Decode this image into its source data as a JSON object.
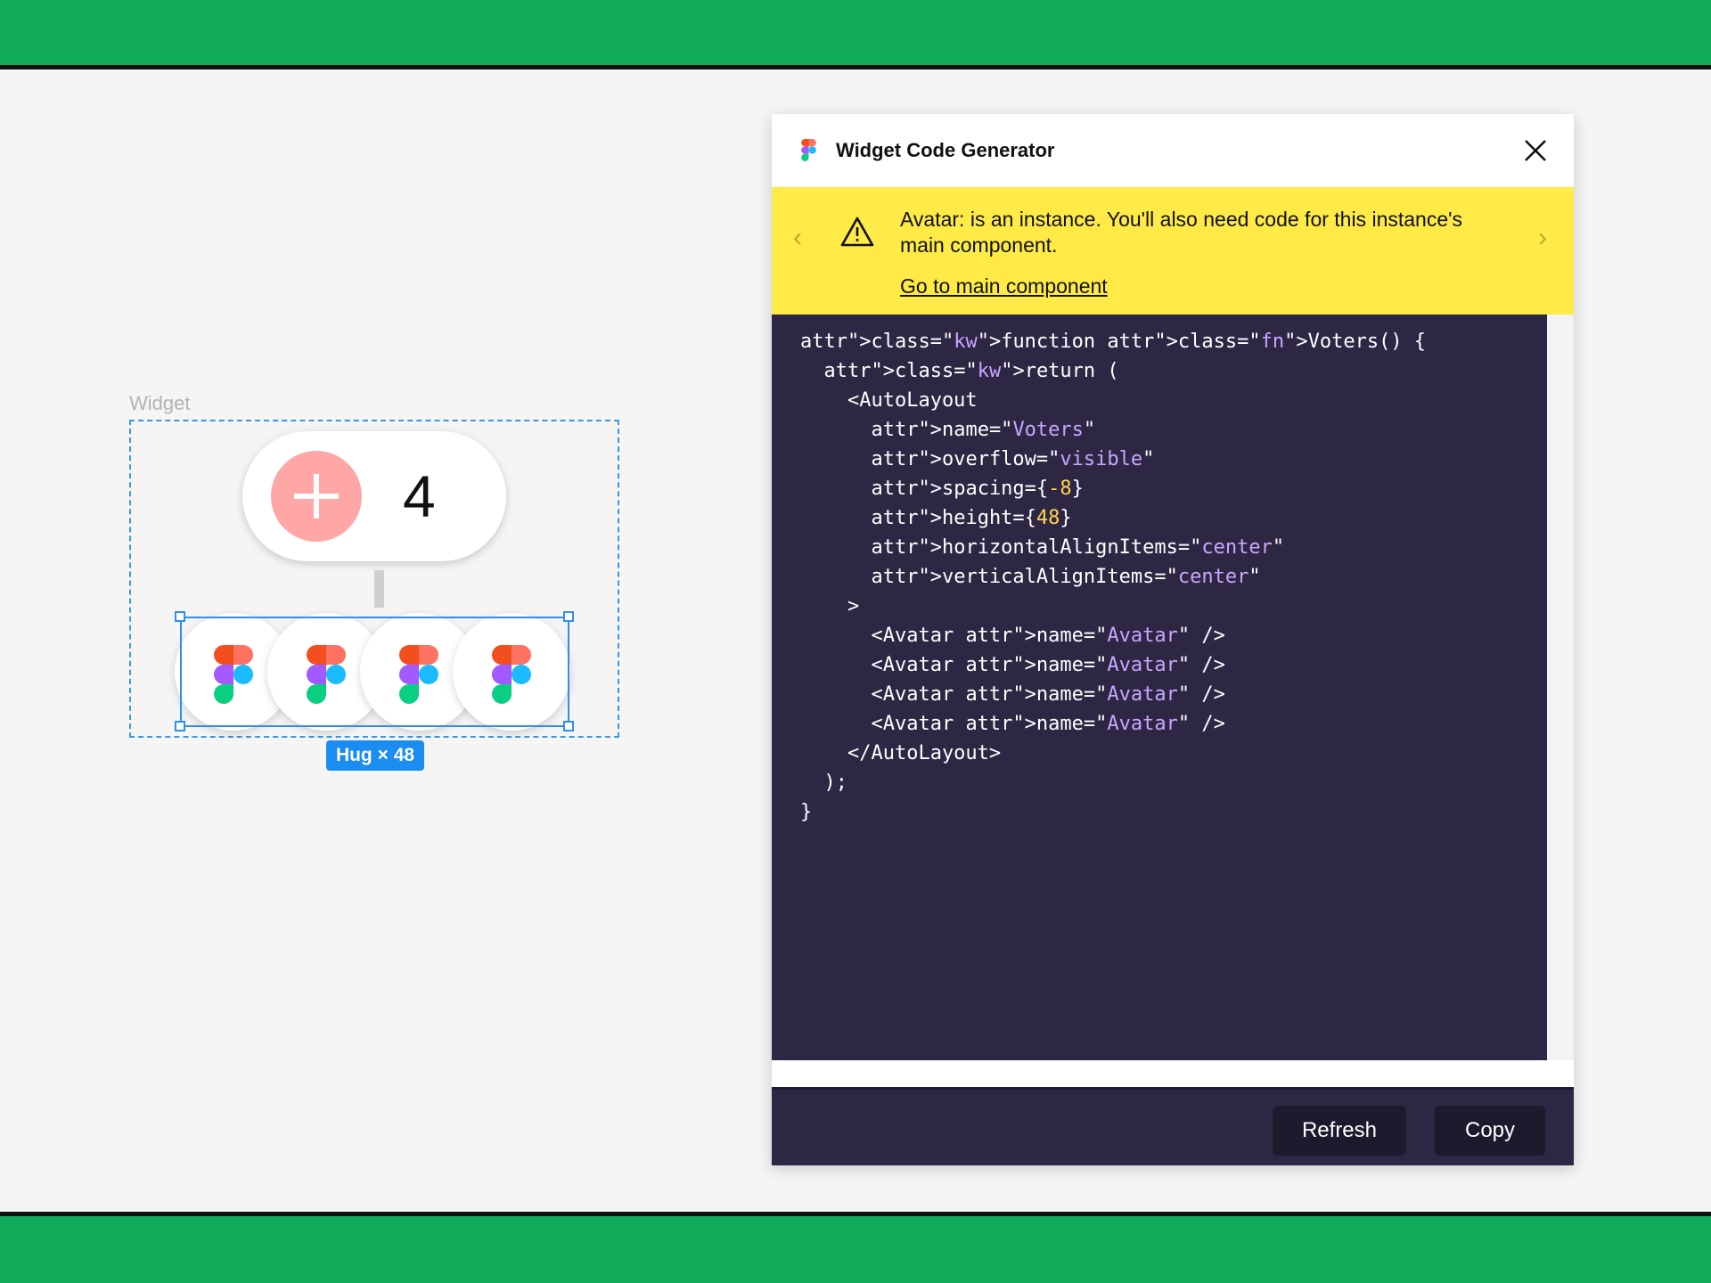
{
  "canvas": {
    "frame_label": "Widget",
    "counter_value": "4",
    "avatar_count": 4,
    "selection_badge": "Hug × 48"
  },
  "dialog": {
    "title": "Widget Code Generator",
    "warning": {
      "message": "Avatar: is an instance. You'll also need code for this instance's main component.",
      "link": "Go to main component"
    },
    "code_lines": [
      "function Voters() {",
      "  return (",
      "    <AutoLayout",
      "      name=\"Voters\"",
      "      overflow=\"visible\"",
      "      spacing={-8}",
      "      height={48}",
      "      horizontalAlignItems=\"center\"",
      "      verticalAlignItems=\"center\"",
      "    >",
      "      <Avatar name=\"Avatar\" />",
      "      <Avatar name=\"Avatar\" />",
      "      <Avatar name=\"Avatar\" />",
      "      <Avatar name=\"Avatar\" />",
      "    </AutoLayout>",
      "  );",
      "}"
    ],
    "buttons": {
      "refresh": "Refresh",
      "copy": "Copy"
    }
  },
  "colors": {
    "band": "#10aa5a",
    "code_bg": "#2d2744",
    "warning_bg": "#ffea47",
    "selection": "#2f8ff0",
    "plus_button": "#ffa6a6"
  },
  "icons": [
    "plus-icon",
    "figma-logo-icon",
    "close-icon",
    "warning-icon",
    "chevron-left-icon",
    "chevron-right-icon"
  ]
}
